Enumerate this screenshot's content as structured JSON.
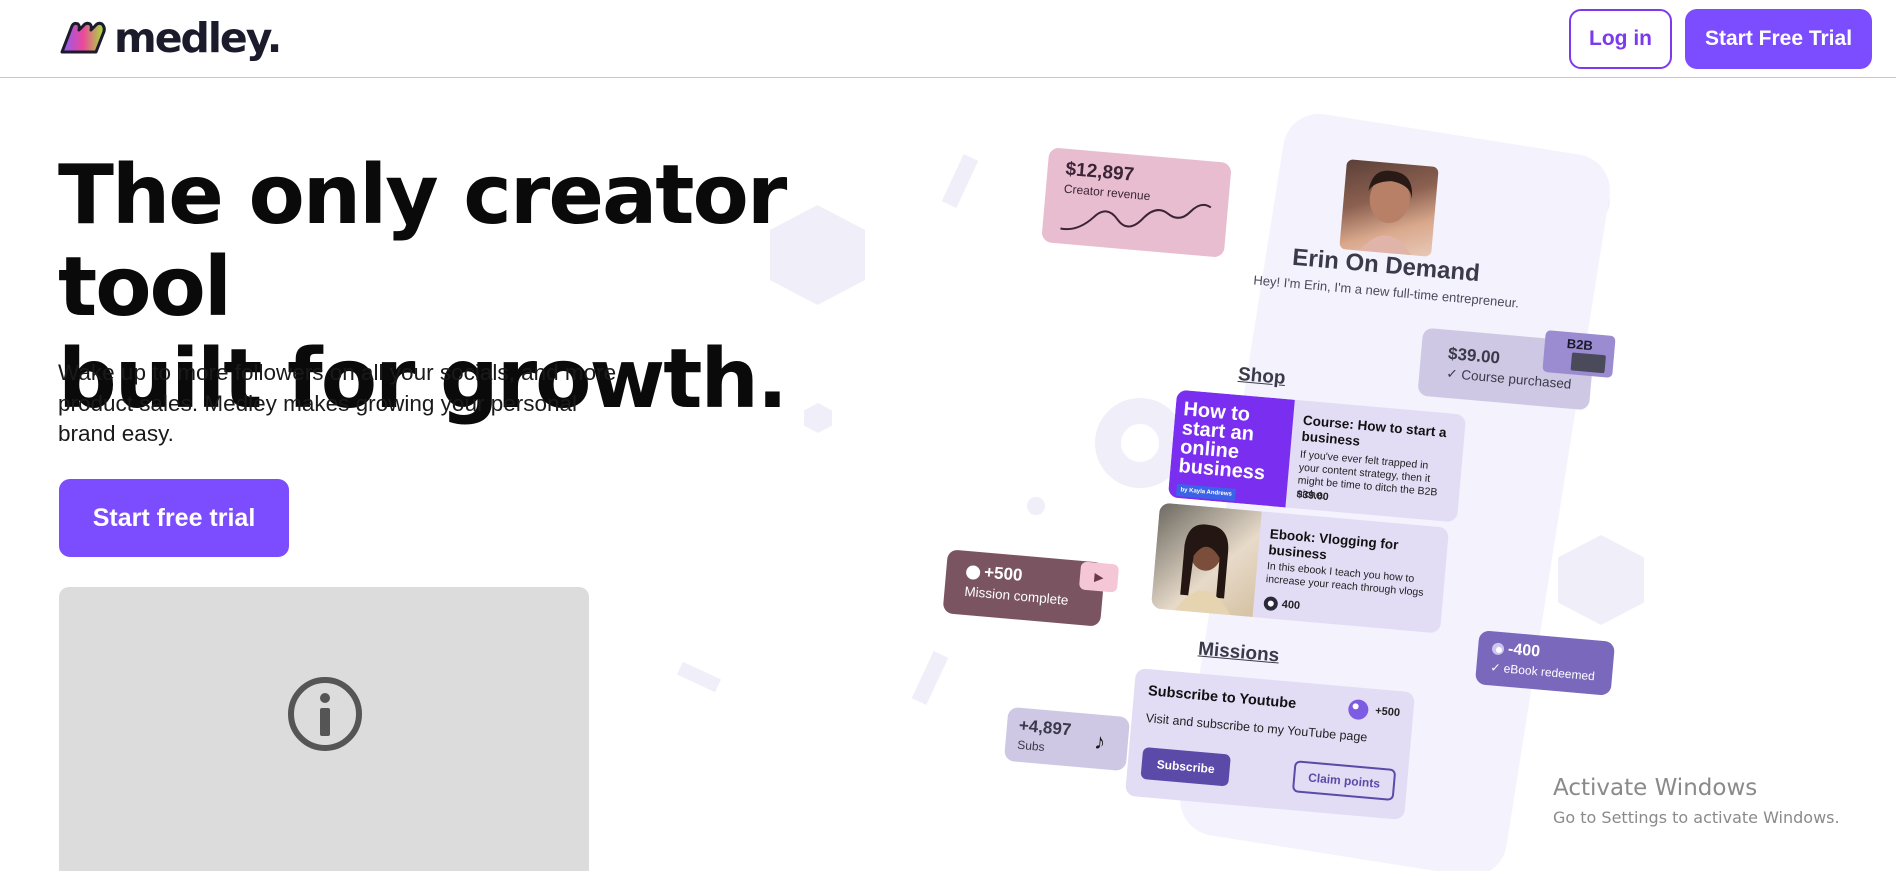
{
  "header": {
    "logo_text": "medley.",
    "login_label": "Log in",
    "trial_label": "Start Free Trial"
  },
  "hero": {
    "title_line1": "The only creator tool",
    "title_line2": "built for growth.",
    "subtitle": "Wake up to more followers on all your socials, and more product sales. Medley makes growing your personal brand easy.",
    "cta_label": "Start free trial",
    "video_icon": "info-icon"
  },
  "illustration": {
    "revenue": {
      "amount": "$12,897",
      "label": "Creator revenue"
    },
    "profile": {
      "name": "Erin On Demand",
      "bio": "Hey! I'm Erin, I'm a new full-time entrepreneur."
    },
    "sections": {
      "shop": "Shop",
      "missions": "Missions"
    },
    "purchase": {
      "amount": "$39.00",
      "label": "Course purchased",
      "thumb_label": "B2B"
    },
    "course": {
      "image_text": "How to start an online business",
      "image_byline": "by Kayla Andrews",
      "title": "Course: How to start a business",
      "description": "If you've ever felt trapped in your content strategy, then it might be time to ditch the B2B niche.",
      "price": "$39.00"
    },
    "ebook": {
      "title": "Ebook: Vlogging for business",
      "description": "In this ebook I teach you how to increase your reach through vlogs",
      "points": "400"
    },
    "mission_complete": {
      "amount": "+500",
      "label": "Mission complete"
    },
    "redeemed": {
      "amount": "-400",
      "label": "eBook redeemed"
    },
    "subs": {
      "amount": "+4,897",
      "label": "Subs"
    },
    "youtube_mission": {
      "title": "Subscribe to Youtube",
      "description": "Visit and subscribe to my YouTube page",
      "points": "+500",
      "subscribe_label": "Subscribe",
      "claim_label": "Claim points"
    }
  },
  "watermark": {
    "title": "Activate Windows",
    "subtitle": "Go to Settings to activate Windows."
  },
  "colors": {
    "brand": "#7c4dff",
    "brand_dark": "#5b4aa8",
    "text": "#0a0a0a"
  }
}
